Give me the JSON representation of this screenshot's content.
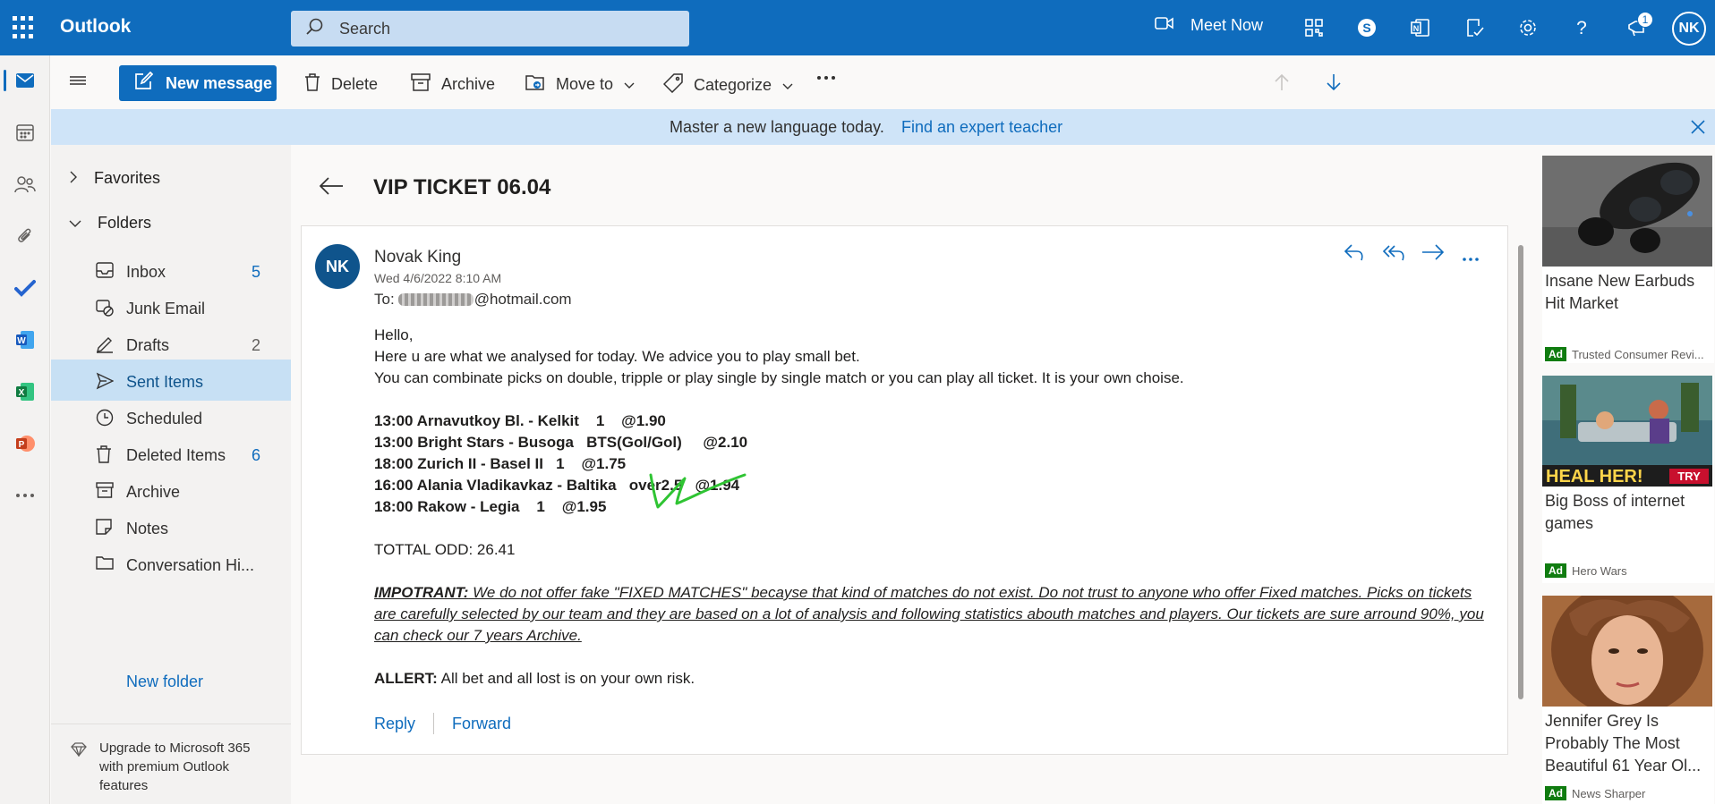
{
  "app": {
    "name": "Outlook"
  },
  "search": {
    "placeholder": "Search"
  },
  "topbar": {
    "meet_now": "Meet Now",
    "notification_count": "1",
    "user_initials": "NK"
  },
  "commands": {
    "new_message": "New message",
    "delete": "Delete",
    "archive": "Archive",
    "move_to": "Move to",
    "categorize": "Categorize"
  },
  "banner": {
    "text": "Master a new language today.",
    "link": "Find an expert teacher"
  },
  "folders": {
    "favorites": "Favorites",
    "folders": "Folders",
    "items": [
      {
        "label": "Inbox",
        "count": "5",
        "icon": "inbox-icon"
      },
      {
        "label": "Junk Email",
        "count": "",
        "icon": "junk-icon"
      },
      {
        "label": "Drafts",
        "count": "2",
        "icon": "drafts-icon"
      },
      {
        "label": "Sent Items",
        "count": "",
        "icon": "send-icon"
      },
      {
        "label": "Scheduled",
        "count": "",
        "icon": "clock-icon"
      },
      {
        "label": "Deleted Items",
        "count": "6",
        "icon": "trash-icon"
      },
      {
        "label": "Archive",
        "count": "",
        "icon": "archive-icon"
      },
      {
        "label": "Notes",
        "count": "",
        "icon": "note-icon"
      },
      {
        "label": "Conversation Hi...",
        "count": "",
        "icon": "folder-icon"
      }
    ],
    "selected": "Sent Items",
    "new_folder": "New folder",
    "upgrade": "Upgrade to Microsoft 365 with premium Outlook features"
  },
  "message": {
    "subject": "VIP TICKET 06.04",
    "sender_initials": "NK",
    "sender_name": "Novak King",
    "date": "Wed 4/6/2022 8:10 AM",
    "to_prefix": "To:",
    "to_suffix": "@hotmail.com",
    "greeting": "Hello,",
    "line1": "Here u are what we analysed for today. We advice you to play small bet.",
    "line2": "You can combinate picks on double, tripple or play single by single match or you can play all ticket. It is your own choise.",
    "picks": [
      "13:00 Arnavutkoy Bl. - Kelkit    1    @1.90",
      "13:00 Bright Stars - Busoga   BTS(Gol/Gol)     @2.10",
      "18:00 Zurich II - Basel II   1    @1.75",
      "16:00 Alania Vladikavkaz - Baltika   over2.5   @1.94",
      "18:00 Rakow - Legia    1    @1.95"
    ],
    "total": "TOTTAL ODD: 26.41",
    "important_label": "IMPOTRANT:",
    "important_text": " We do not offer fake \"FIXED MATCHES\" becayse that kind of matches do not exist. Do not trust to anyone who offer Fixed matches. Picks on tickets are carefully selected by our team and they are based on a lot of analysis and following statistics abouth matches and players. Our tickets are sure arround 90%, you can check our 7 years Archive.",
    "alert_label": "ALLERT:",
    "alert_text": " All bet and all lost is on your own risk.",
    "reply": "Reply",
    "forward": "Forward"
  },
  "ads": [
    {
      "title": "Insane New Earbuds Hit Market",
      "badge": "Ad",
      "source": "Trusted Consumer Revi..."
    },
    {
      "title": "Big Boss of internet games",
      "badge": "Ad",
      "source": "Hero Wars",
      "image_text": "HEAL HER!",
      "image_button": "TRY"
    },
    {
      "title": "Jennifer Grey Is Probably The Most Beautiful 61 Year Ol...",
      "badge": "Ad",
      "source": "News Sharper"
    }
  ],
  "colors": {
    "brand": "#0f6cbd",
    "selected_folder": "#c7e0f4",
    "ad_badge": "#107c10",
    "scribble": "#2fc433"
  }
}
